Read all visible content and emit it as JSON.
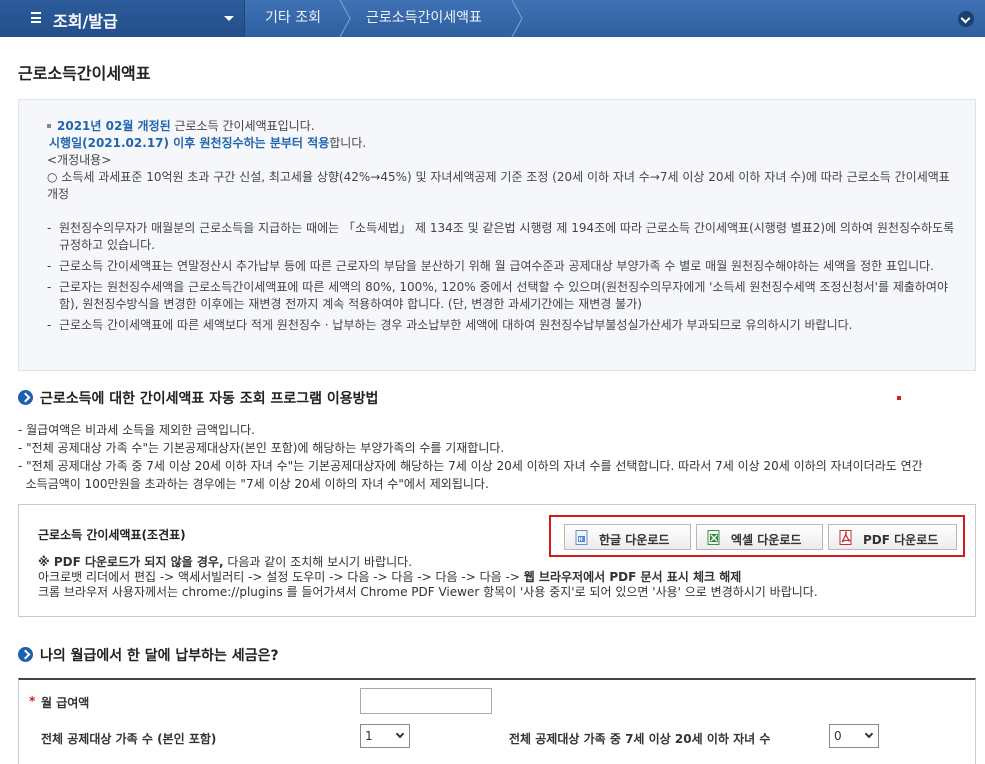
{
  "nav": {
    "menu_title": "조회/발급",
    "breadcrumb_1": "기타 조회",
    "breadcrumb_2": "근로소득간이세액표"
  },
  "page": {
    "title": "근로소득간이세액표"
  },
  "info": {
    "line1_blue": "2021년 02월 개정된",
    "line1_rest": " 근로소득 간이세액표입니다.",
    "line2_blue": "시행일(2021.02.17) 이후 원천징수하는 분부터 적용",
    "line2_rest": "합니다.",
    "change_header": "<개정내용>",
    "change_item": "○ 소득세 과세표준 10억원 초과 구간 신설, 최고세율 상향(42%→45%) 및 자녀세액공제 기준 조정 (20세 이하 자녀 수→7세 이상 20세 이하 자녀 수)에 따라 근로소득 간이세액표 개정",
    "items": [
      "원천징수의무자가 매월분의 근로소득을 지급하는 때에는 「소득세법」 제 134조 및 같은법 시행령 제 194조에 따라 근로소득 간이세액표(시행령 별표2)에 의하여 원천징수하도록 규정하고 있습니다.",
      "근로소득 간이세액표는 연말정산시 추가납부 등에 따른 근로자의 부담을 분산하기 위해 월 급여수준과 공제대상 부양가족 수 별로 매월 원천징수해야하는 세액을 정한 표입니다.",
      "근로자는 원천징수세액을 근로소득간이세액표에 따른 세액의 80%, 100%, 120% 중에서 선택할 수 있으며(원천징수의무자에게 '소득세 원천징수세액 조정신청서'를 제출하여야 함), 원천징수방식을 변경한 이후에는 재변경 전까지 계속 적용하여야 합니다. (단, 변경한 과세기간에는 재변경 불가)",
      "근로소득 간이세액표에 따른 세액보다 적게 원천징수 · 납부하는 경우 과소납부한 세액에 대하여 원천징수납부불성실가산세가 부과되므로 유의하시기 바랍니다."
    ]
  },
  "section1": {
    "heading": "근로소득에 대한 간이세액표 자동 조회 프로그램 이용방법",
    "notes": [
      "- 월급여액은  비과세 소득을 제외한 금액입니다.",
      "- \"전체 공제대상 가족 수\"는 기본공제대상자(본인 포함)에 해당하는 부양가족의 수를 기재합니다.",
      "- \"전체 공제대상 가족 중 7세 이상 20세 이하 자녀 수\"는 기본공제대상자에 해당하는 7세 이상 20세 이하의 자녀 수를 선택합니다. 따라서 7세 이상 20세 이하의 자녀이더라도 연간",
      "  소득금액이 100만원을 초과하는 경우에는 \"7세 이상 20세 이하의 자녀 수\"에서 제외됩니다."
    ]
  },
  "download": {
    "title": "근로소득 간이세액표(조견표)",
    "btn_hangul": "한글 다운로드",
    "btn_excel": "엑셀 다운로드",
    "btn_pdf": "PDF 다운로드",
    "help_bold": "※ PDF 다운로드가 되지 않을 경우,",
    "help_rest": " 다음과 같이 조치해 보시기 바랍니다.",
    "help2_plain": "아크로뱃 리더에서 편집 -> 액세서빌러티 -> 설정 도우미 -> 다음 -> 다음 -> 다음 -> 다음 -> ",
    "help2_bold": "웹 브라우저에서 PDF 문서 표시 체크 해제",
    "help3": "크롬 브라우저 사용자께서는 chrome://plugins 를 들어가셔서 Chrome PDF Viewer 항목이 '사용 중지'로 되어 있으면 '사용' 으로 변경하시기 바랍니다."
  },
  "section2": {
    "heading": "나의 월급에서 한 달에 납부하는 세금은?"
  },
  "form": {
    "required_mark": "*",
    "salary_label": "월 급여액",
    "salary_value": "",
    "family_label": "전체 공제대상 가족 수 (본인 포함)",
    "family_value": "1",
    "children_label": "전체 공제대상 가족 중 7세 이상 20세 이하 자녀 수",
    "children_value": "0"
  },
  "colors": {
    "nav_bg": "#3a6cae",
    "accent_blue": "#2266aa",
    "highlight_red": "#d21c1c"
  }
}
